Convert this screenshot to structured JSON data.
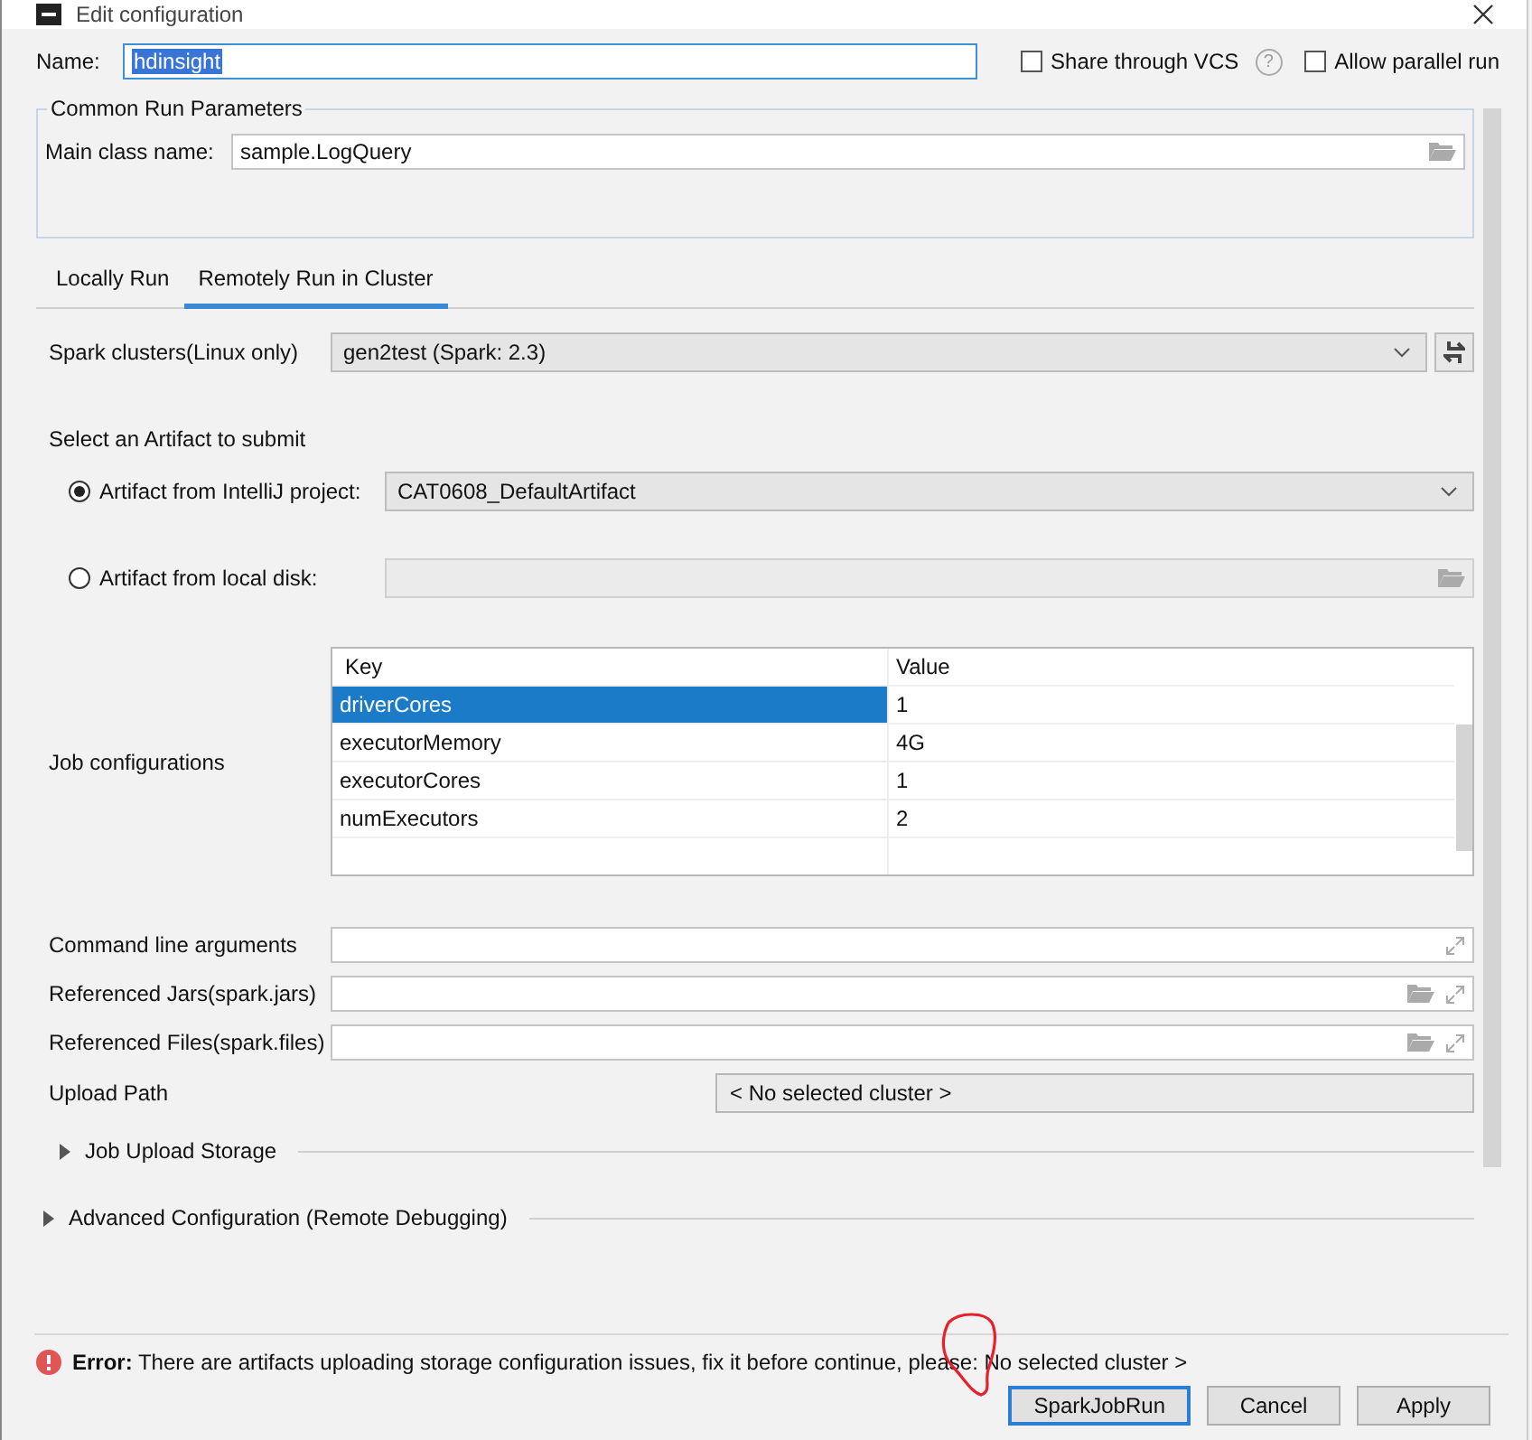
{
  "window": {
    "title": "Edit configuration"
  },
  "name_field": {
    "label": "Name:",
    "value": "hdinsight",
    "text_selected": true
  },
  "options": [
    {
      "label": "Share through VCS",
      "checked": false,
      "help": "?"
    },
    {
      "label": "Allow parallel run",
      "checked": false
    }
  ],
  "common_params": {
    "title": "Common Run Parameters",
    "label": "Main class name:",
    "value": "sample.LogQuery"
  },
  "tabs": [
    {
      "label": "Locally Run",
      "selected": false
    },
    {
      "label": "Remotely Run in Cluster",
      "selected": true
    }
  ],
  "spark_clusters": {
    "label": "Spark clusters(Linux only)",
    "value": "gen2test (Spark: 2.3)"
  },
  "artifact": {
    "title": "Select an Artifact to submit",
    "options": [
      {
        "label": "Artifact from IntelliJ project:",
        "selected": true,
        "kind": "dropdown",
        "value": "CAT0608_DefaultArtifact"
      },
      {
        "label": "Artifact from local disk:",
        "selected": false,
        "kind": "file"
      }
    ]
  },
  "job_config": {
    "label": "Job configurations",
    "columns": [
      "Key",
      "Value"
    ],
    "rows": [
      {
        "key": "driverCores",
        "value": "1",
        "selected": true
      },
      {
        "key": "executorMemory",
        "value": "4G",
        "selected": false
      },
      {
        "key": "executorCores",
        "value": "1",
        "selected": false
      },
      {
        "key": "numExecutors",
        "value": "2",
        "selected": false
      }
    ]
  },
  "fields": [
    {
      "label": "Command line arguments",
      "kind": "expand"
    },
    {
      "label": "Referenced Jars(spark.jars)",
      "kind": "browse"
    },
    {
      "label": "Referenced Files(spark.files)",
      "kind": "browse"
    }
  ],
  "upload_path": {
    "label": "Upload Path",
    "value": "< No selected cluster >"
  },
  "job_upload_storage": {
    "label": "Job Upload Storage",
    "expanded": false
  },
  "advanced_configuration": {
    "label": "Advanced Configuration (Remote Debugging)",
    "expanded": false
  },
  "error": {
    "text": "**Error:** There are artifacts uploading storage configuration issues, fix it before continue, please: No selected cluster >"
  },
  "buttons": [
    {
      "label": "SparkJobRun",
      "default": true
    },
    {
      "label": "Cancel",
      "default": false
    },
    {
      "label": "Apply",
      "default": false
    }
  ]
}
